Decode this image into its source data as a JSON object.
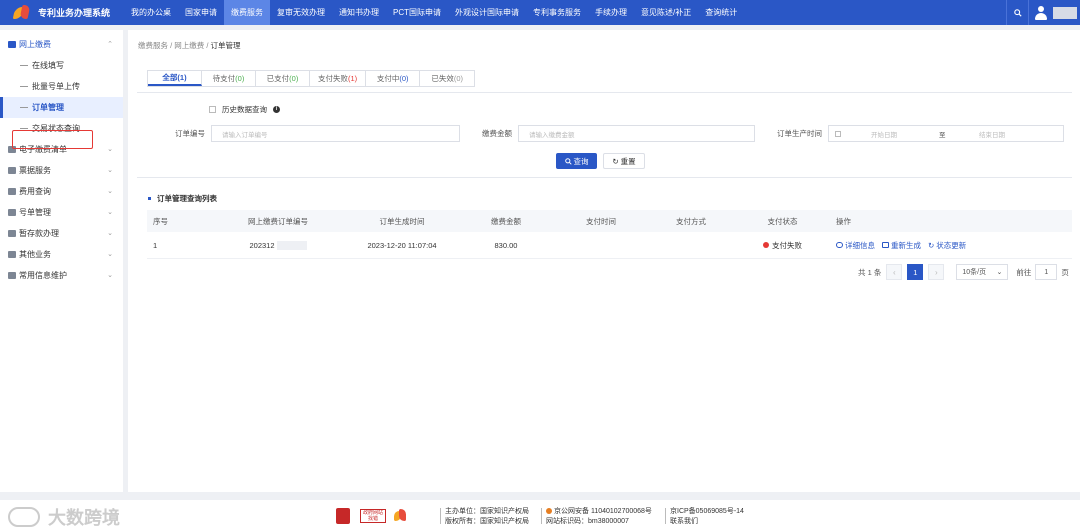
{
  "header": {
    "app_title": "专利业务办理系统",
    "nav": [
      "我的办公桌",
      "国家申请",
      "缴费服务",
      "复审无效办理",
      "通知书办理",
      "PCT国际申请",
      "外观设计国际申请",
      "专利事务服务",
      "手续办理",
      "意见陈述/补正",
      "查询统计"
    ],
    "active_nav": "缴费服务",
    "search_icon": "search-icon",
    "user_icon": "user-icon"
  },
  "sidebar": {
    "groups": [
      {
        "label": "网上缴费",
        "icon": "wallet-icon",
        "open": true,
        "items": [
          "在线填写",
          "批量号单上传",
          "订单管理",
          "交易状态查询"
        ],
        "active_item": "订单管理"
      },
      {
        "label": "电子缴费清单",
        "icon": "list-icon"
      },
      {
        "label": "票据服务",
        "icon": "receipt-icon"
      },
      {
        "label": "费用查询",
        "icon": "money-icon"
      },
      {
        "label": "号单管理",
        "icon": "file-icon"
      },
      {
        "label": "暂存款办理",
        "icon": "deposit-icon"
      },
      {
        "label": "其他业务",
        "icon": "grid-icon"
      },
      {
        "label": "常用信息维护",
        "icon": "settings-icon"
      }
    ]
  },
  "breadcrumb": [
    "缴费服务",
    "网上缴费",
    "订单管理"
  ],
  "tabs": [
    {
      "label": "全部",
      "count": "(1)"
    },
    {
      "label": "待支付",
      "count": "(0)"
    },
    {
      "label": "已支付",
      "count": "(0)"
    },
    {
      "label": "支付失败",
      "count": "(1)"
    },
    {
      "label": "支付中",
      "count": "(0)"
    },
    {
      "label": "已失效",
      "count": "(0)"
    }
  ],
  "filter": {
    "history_label": "历史数据查询",
    "order_no_label": "订单编号",
    "order_no_placeholder": "请输入订单编号",
    "amount_label": "缴费金额",
    "amount_placeholder": "请输入缴费金额",
    "time_label": "订单生产时间",
    "start_placeholder": "开始日期",
    "range_sep": "至",
    "end_placeholder": "结束日期",
    "search_button": "查询",
    "reset_button": "重置"
  },
  "list": {
    "title": "订单管理查询列表",
    "columns": [
      "序号",
      "网上缴费订单编号",
      "订单生成时间",
      "缴费金额",
      "支付时间",
      "支付方式",
      "支付状态",
      "操作"
    ],
    "rows": [
      {
        "index": "1",
        "order_no": "202312",
        "created": "2023-12-20 11:07:04",
        "amount": "830.00",
        "pay_time": "",
        "pay_method": "",
        "status": "支付失败",
        "ops": [
          "详细信息",
          "重新生成",
          "状态更新"
        ]
      }
    ]
  },
  "pager": {
    "total": "共 1 条",
    "current": "1",
    "page_size": "10条/页",
    "goto_label": "前往",
    "goto_value": "1",
    "page_unit": "页"
  },
  "footer": {
    "gov_badge_line1": "政府网站",
    "gov_badge_line2": "找错",
    "host": "主办单位：国家知识产权局",
    "copyright": "版权所有：国家知识产权局",
    "police": "京公网安备 11040102700068号",
    "site_code": "网站标识码：bm38000007",
    "icp": "京ICP备05069085号-14",
    "contact": "联系我们",
    "watermark": "大数跨境"
  }
}
